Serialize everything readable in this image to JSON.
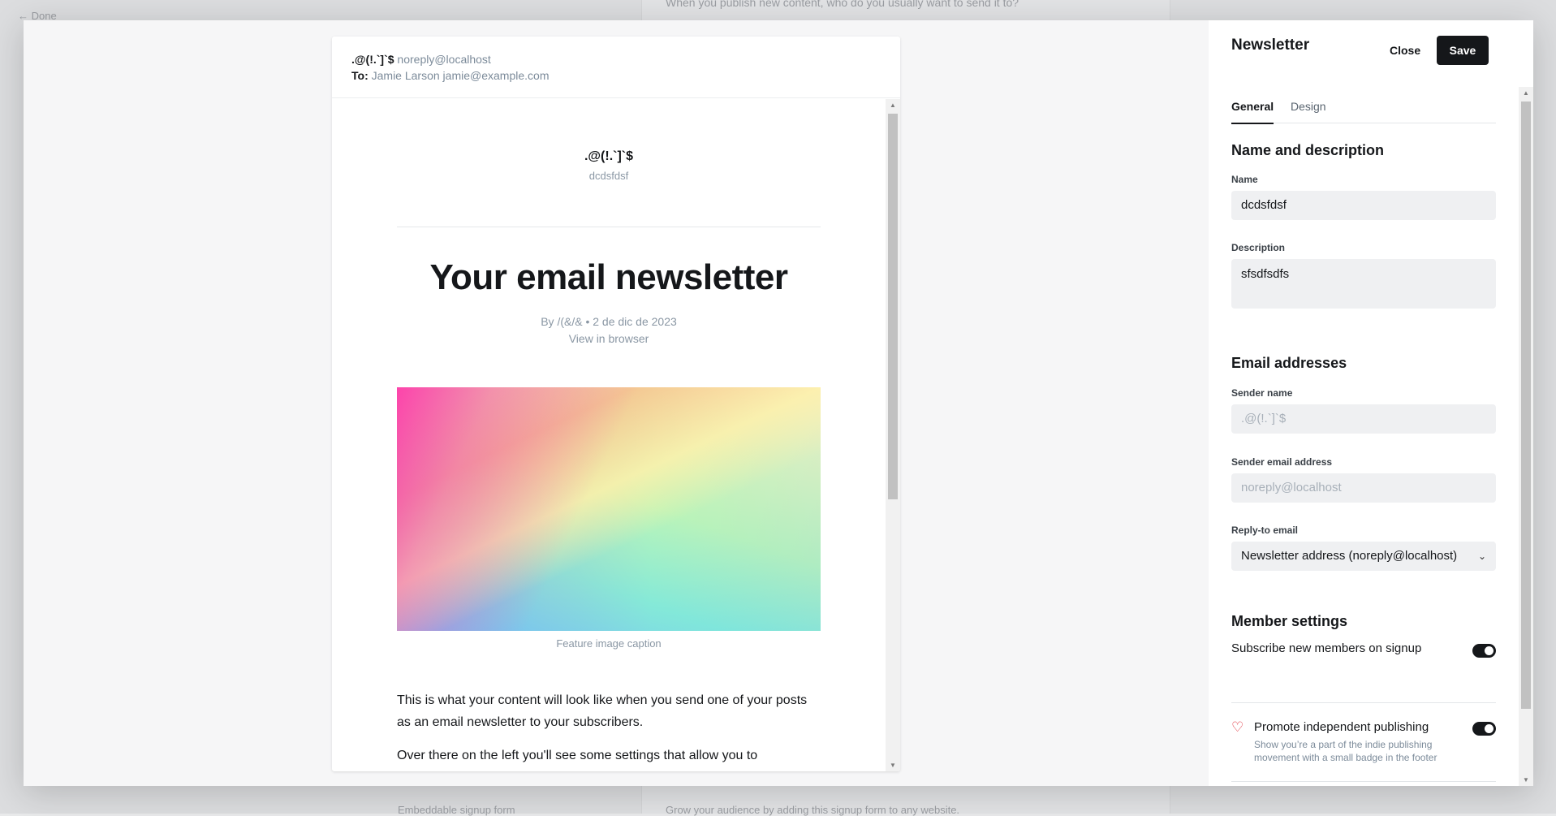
{
  "background": {
    "back_label": "← Done",
    "question": "When you publish new content, who do you usually want to send it to?",
    "embed_label": "Embeddable signup form",
    "footer_text": "Grow your audience by adding this signup form to any website."
  },
  "email_preview": {
    "from_name": ".@(!.`]`$",
    "from_email": "noreply@localhost",
    "to_label": "To:",
    "to_value": "Jamie Larson jamie@example.com",
    "publication_title": ".@(!.`]`$",
    "publication_subtitle": "dcdsfdsf",
    "headline": "Your email newsletter",
    "byline": "By /(&/& • 2 de dic de 2023",
    "view_in_browser": "View in browser",
    "image_caption": "Feature image caption",
    "paragraph_1": "This is what your content will look like when you send one of your posts as an email newsletter to your subscribers.",
    "paragraph_2": "Over there on the left you'll see some settings that allow you to"
  },
  "panel": {
    "title": "Newsletter",
    "close_label": "Close",
    "save_label": "Save",
    "tabs": [
      "General",
      "Design"
    ],
    "name_section": {
      "title": "Name and description",
      "name_label": "Name",
      "name_value": "dcdsfdsf",
      "description_label": "Description",
      "description_value": "sfsdfsdfs"
    },
    "email_section": {
      "title": "Email addresses",
      "sender_name_label": "Sender name",
      "sender_name_placeholder": ".@(!.`]`$",
      "sender_email_label": "Sender email address",
      "sender_email_placeholder": "noreply@localhost",
      "reply_to_label": "Reply-to email",
      "reply_to_value": "Newsletter address (noreply@localhost)"
    },
    "member_section": {
      "title": "Member settings",
      "subscribe_label": "Subscribe new members on signup",
      "subscribe_on": true,
      "promote_label": "Promote independent publishing",
      "promote_desc": "Show you’re a part of the indie publishing movement with a small badge in the footer",
      "promote_on": true
    }
  },
  "colors": {
    "primary": "#15171a",
    "muted": "#7c8b9a",
    "accent_heart": "#e0323d"
  }
}
